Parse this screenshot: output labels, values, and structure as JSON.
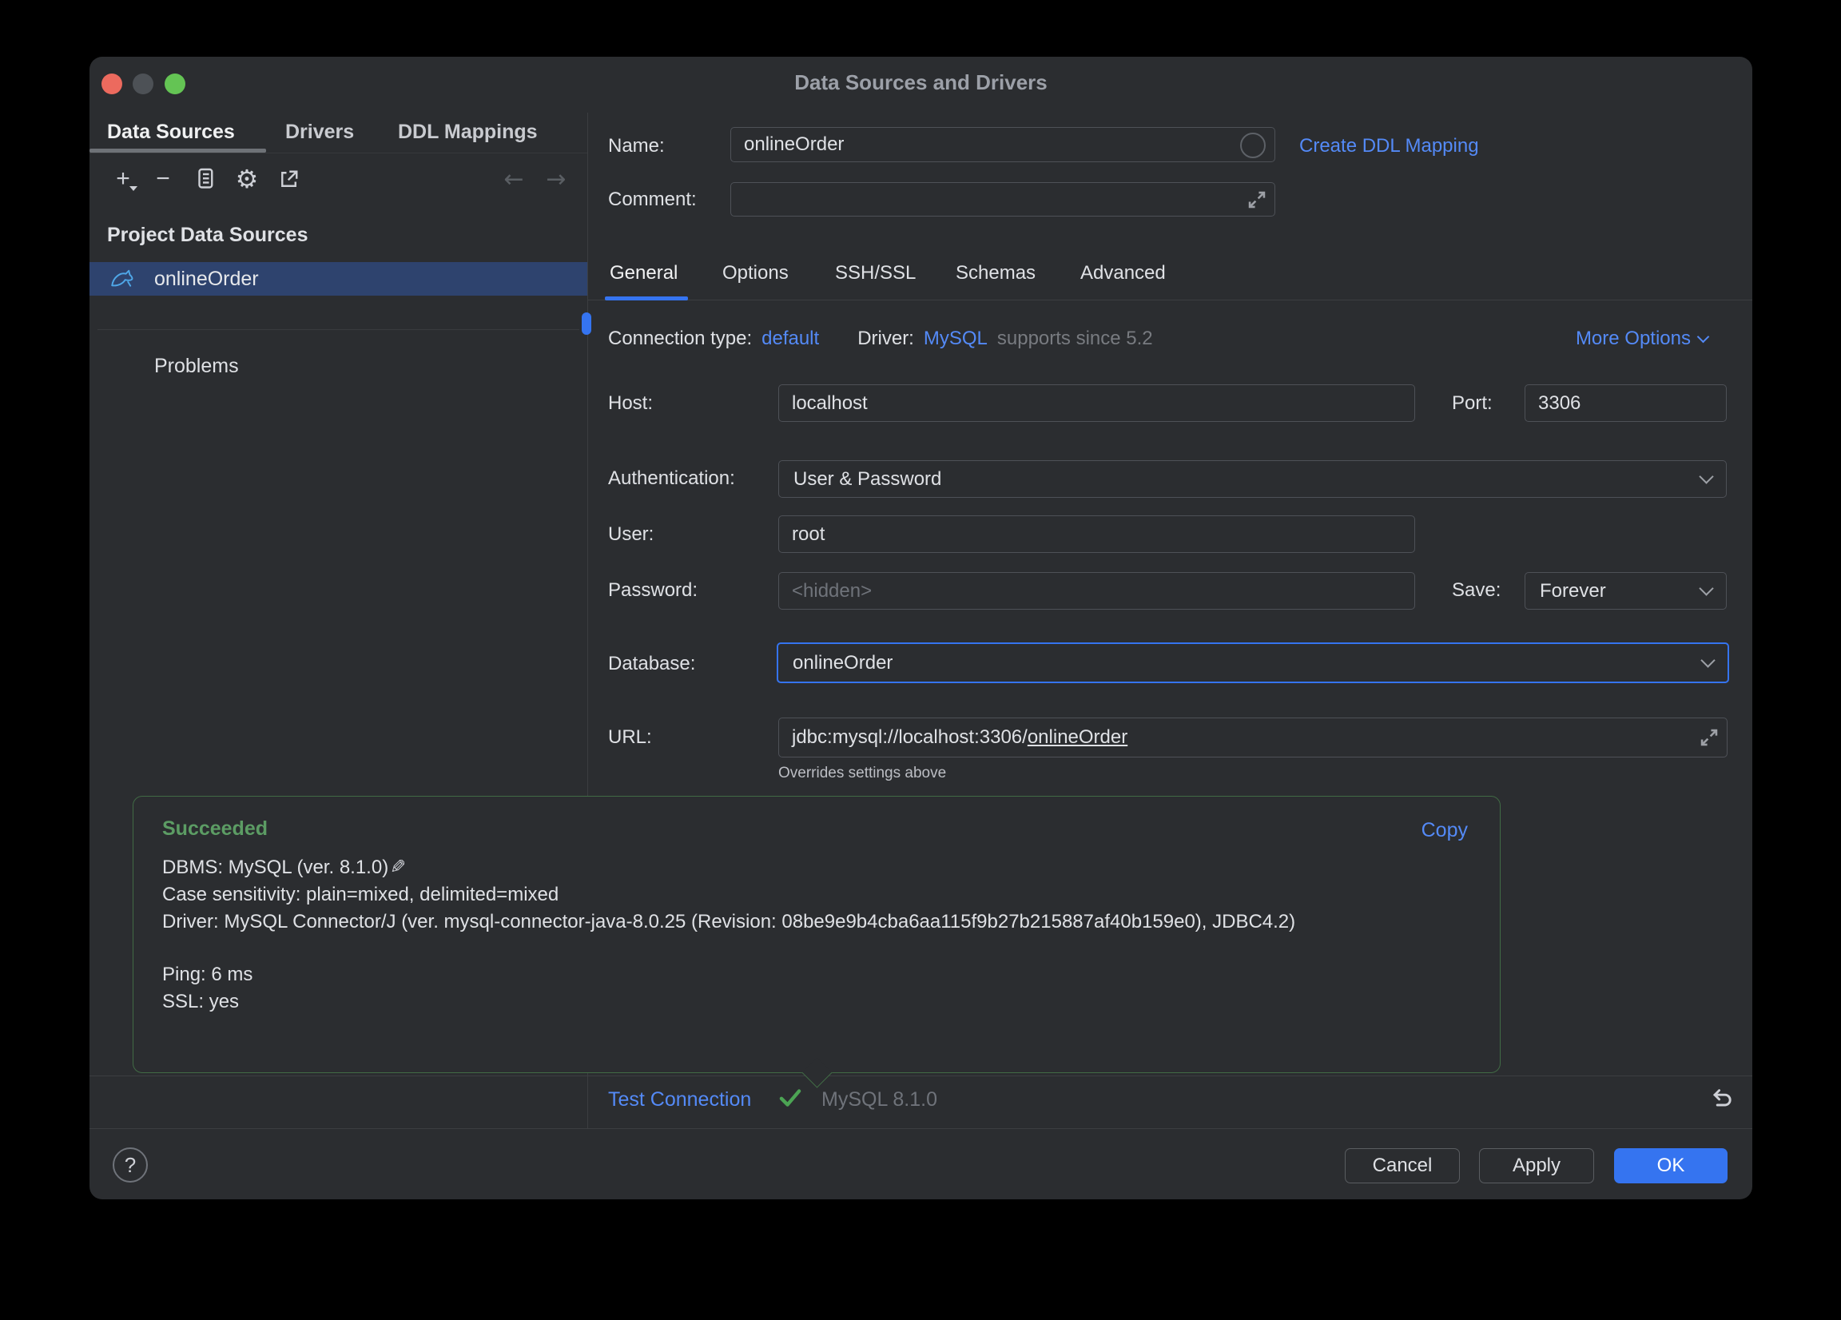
{
  "window": {
    "title": "Data Sources and Drivers"
  },
  "sidebar": {
    "tabs": [
      {
        "label": "Data Sources",
        "active": true
      },
      {
        "label": "Drivers",
        "active": false
      },
      {
        "label": "DDL Mappings",
        "active": false
      }
    ],
    "section_header": "Project Data Sources",
    "items": [
      {
        "label": "onlineOrder",
        "selected": true,
        "icon": "mysql-dolphin"
      }
    ],
    "problems_label": "Problems"
  },
  "icons": {
    "plus": "+",
    "minus": "−",
    "back": "←",
    "forward": "→",
    "gear": "⚙",
    "help": "?",
    "pencil": "✎"
  },
  "form": {
    "name_label": "Name:",
    "name_value": "onlineOrder",
    "create_ddl_link": "Create DDL Mapping",
    "comment_label": "Comment:",
    "comment_value": "",
    "tabs": [
      "General",
      "Options",
      "SSH/SSL",
      "Schemas",
      "Advanced"
    ],
    "active_tab": "General",
    "connection_type_label": "Connection type:",
    "connection_type_value": "default",
    "driver_label": "Driver:",
    "driver_value": "MySQL",
    "driver_note": "supports since 5.2",
    "more_options_label": "More Options",
    "host_label": "Host:",
    "host_value": "localhost",
    "port_label": "Port:",
    "port_value": "3306",
    "auth_label": "Authentication:",
    "auth_value": "User & Password",
    "user_label": "User:",
    "user_value": "root",
    "password_label": "Password:",
    "password_placeholder": "<hidden>",
    "save_label": "Save:",
    "save_value": "Forever",
    "database_label": "Database:",
    "database_value": "onlineOrder",
    "url_label": "URL:",
    "url_prefix": "jdbc:mysql://localhost:3306/",
    "url_db": "onlineOrder",
    "url_note": "Overrides settings above"
  },
  "result_panel": {
    "status": "Succeeded",
    "copy_link": "Copy",
    "lines": [
      "DBMS: MySQL (ver. 8.1.0)",
      "Case sensitivity: plain=mixed, delimited=mixed",
      "Driver: MySQL Connector/J (ver. mysql-connector-java-8.0.25 (Revision: 08be9e9b4cba6aa115f9b27b215887af40b159e0), JDBC4.2)",
      "Ping: 6 ms",
      "SSL: yes"
    ]
  },
  "status_row": {
    "test_connection_label": "Test Connection",
    "server_version": "MySQL 8.1.0"
  },
  "footer": {
    "cancel_label": "Cancel",
    "apply_label": "Apply",
    "ok_label": "OK"
  },
  "colors": {
    "accent_blue": "#3574F0",
    "link_blue": "#548AF7",
    "success_green": "#5C9C64",
    "selection_blue": "#2E436E",
    "traffic_close": "#EC6A5E",
    "traffic_minimize": "#4D5156",
    "traffic_zoom": "#64C454"
  }
}
